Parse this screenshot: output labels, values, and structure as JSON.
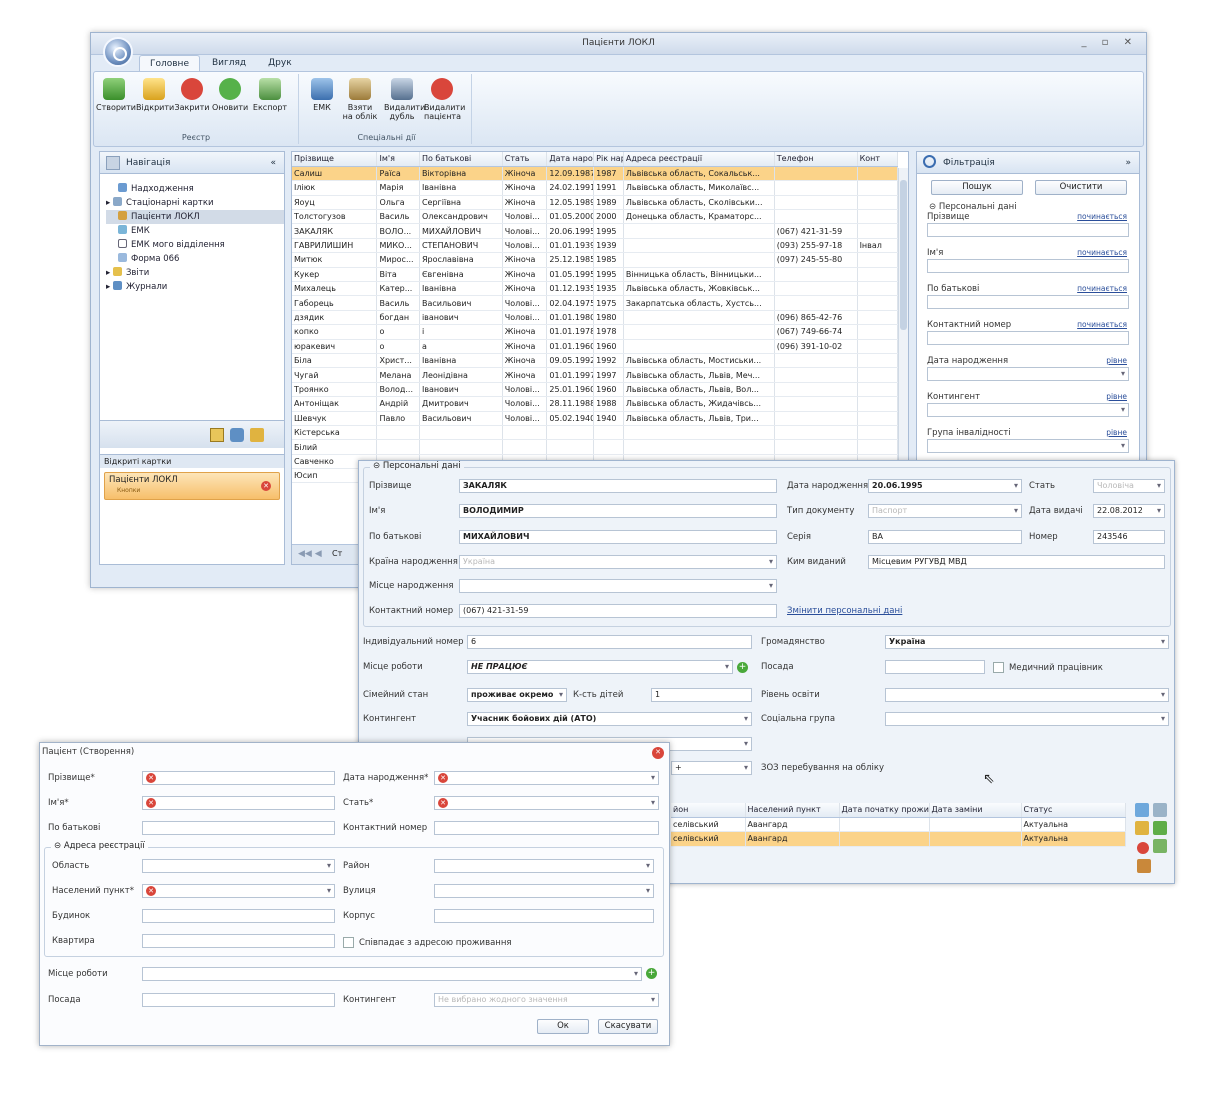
{
  "window": {
    "title": "Пацієнти ЛОКЛ"
  },
  "tabs": [
    "Головне",
    "Вигляд",
    "Друк"
  ],
  "ribbon": {
    "registry": {
      "label": "Реєстр",
      "buttons": [
        "Створити",
        "Відкрити",
        "Закрити",
        "Оновити",
        "Експорт"
      ]
    },
    "special": {
      "label": "Спеціальні дії",
      "buttons": [
        "ЕМК",
        "Взяти на облік",
        "Видалити дубль",
        "Видалити пацієнта"
      ]
    }
  },
  "nav": {
    "title": "Навігація",
    "items": [
      "Надходження",
      "Стаціонарні картки",
      "Пацієнти ЛОКЛ",
      "ЕМК",
      "ЕМК мого відділення",
      "Форма 066",
      "Звіти",
      "Журнали"
    ],
    "open_cards_title": "Відкриті картки",
    "open_card": {
      "title": "Пацієнти ЛОКЛ",
      "sub": "Кнопки"
    }
  },
  "grid": {
    "columns": [
      "Прізвище",
      "Ім'я",
      "По батькові",
      "Стать",
      "Дата народж",
      "Рік нарож",
      "Адреса реєстрації",
      "Телефон",
      "Конт"
    ],
    "rows": [
      [
        "Салиш",
        "Раїса",
        "Вікторівна",
        "Жіноча",
        "12.09.1987",
        "1987",
        "Львівська область, Сокальськ...",
        "",
        ""
      ],
      [
        "Іліюк",
        "Марія",
        "Іванівна",
        "Жіноча",
        "24.02.1991",
        "1991",
        "Львівська область, Миколаївс...",
        "",
        ""
      ],
      [
        "Яоуц",
        "Ольга",
        "Сергіївна",
        "Жіноча",
        "12.05.1989",
        "1989",
        "Львівська область, Сколівськи...",
        "",
        ""
      ],
      [
        "Толстогузов",
        "Василь",
        "Олександрович",
        "Чолові...",
        "01.05.2000",
        "2000",
        "Донецька область, Краматорс...",
        "",
        ""
      ],
      [
        "ЗАКАЛЯК",
        "ВОЛО...",
        "МИХАЙЛОВИЧ",
        "Чолові...",
        "20.06.1995",
        "1995",
        "",
        "(067) 421-31-59",
        ""
      ],
      [
        "ГАВРИЛИШИН",
        "МИКО...",
        "СТЕПАНОВИЧ",
        "Чолові...",
        "01.01.1939",
        "1939",
        "",
        "(093) 255-97-18",
        "Інвал"
      ],
      [
        "Митюк",
        "Мирос...",
        "Ярославівна",
        "Жіноча",
        "25.12.1985",
        "1985",
        "",
        "(097) 245-55-80",
        ""
      ],
      [
        "Кукер",
        "Віта",
        "Євгенівна",
        "Жіноча",
        "01.05.1995",
        "1995",
        "Вінницька область, Вінницьки...",
        "",
        ""
      ],
      [
        "Михалець",
        "Катер...",
        "Іванівна",
        "Жіноча",
        "01.12.1935",
        "1935",
        "Львівська область, Жовківськ...",
        "",
        ""
      ],
      [
        "Габорець",
        "Василь",
        "Васильович",
        "Чолові...",
        "02.04.1975",
        "1975",
        "Закарпатська область, Хустсь...",
        "",
        ""
      ],
      [
        "дзядик",
        "богдан",
        "іванович",
        "Чолові...",
        "01.01.1980",
        "1980",
        "",
        "(096) 865-42-76",
        ""
      ],
      [
        "копко",
        "о",
        "і",
        "Жіноча",
        "01.01.1978",
        "1978",
        "",
        "(067) 749-66-74",
        ""
      ],
      [
        "юракевич",
        "о",
        "а",
        "Жіноча",
        "01.01.1960",
        "1960",
        "",
        "(096) 391-10-02",
        ""
      ],
      [
        "Біла",
        "Христ...",
        "Іванівна",
        "Жіноча",
        "09.05.1992",
        "1992",
        "Львівська область, Мостиськи...",
        "",
        ""
      ],
      [
        "Чугай",
        "Мелана",
        "Леонідівна",
        "Жіноча",
        "01.01.1997",
        "1997",
        "Львівська область, Львів, Меч...",
        "",
        ""
      ],
      [
        "Троянко",
        "Волод...",
        "Іванович",
        "Чолові...",
        "25.01.1960",
        "1960",
        "Львівська область, Львів, Вол...",
        "",
        ""
      ],
      [
        "Антоніщак",
        "Андрій",
        "Дмитрович",
        "Чолові...",
        "28.11.1988",
        "1988",
        "Львівська область, Жидачівсь...",
        "",
        ""
      ],
      [
        "Шевчук",
        "Павло",
        "Васильович",
        "Чолові...",
        "05.02.1940",
        "1940",
        "Львівська область, Львів, Три...",
        "",
        ""
      ],
      [
        "Кістерська",
        "",
        "",
        "",
        "",
        "",
        "",
        "",
        ""
      ],
      [
        "Білий",
        "",
        "",
        "",
        "",
        "",
        "",
        "",
        ""
      ],
      [
        "Савченко",
        "",
        "",
        "",
        "",
        "",
        "",
        "",
        ""
      ],
      [
        "Юсип",
        "",
        "",
        "",
        "",
        "",
        "",
        "",
        ""
      ]
    ],
    "pager_label": "Ст"
  },
  "filter": {
    "title": "Фільтрація",
    "search": "Пошук",
    "clear": "Очистити",
    "group": "Персональні дані",
    "fields": [
      {
        "label": "Прізвище",
        "mode": "починається"
      },
      {
        "label": "Ім'я",
        "mode": "починається"
      },
      {
        "label": "По батькові",
        "mode": "починається"
      },
      {
        "label": "Контактний номер",
        "mode": "починається"
      },
      {
        "label": "Дата народження",
        "mode": "рівне"
      },
      {
        "label": "Контингент",
        "mode": "рівне"
      },
      {
        "label": "Група інвалідності",
        "mode": "рівне"
      }
    ]
  },
  "emk": {
    "group": "Персональні дані",
    "surname_label": "Прізвище",
    "surname": "ЗАКАЛЯК",
    "name_label": "Ім'я",
    "name": "ВОЛОДИМИР",
    "patronymic_label": "По батькові",
    "patronymic": "МИХАЙЛОВИЧ",
    "country_label": "Країна народження",
    "country": "Україна",
    "birthplace_label": "Місце народження",
    "phone_label": "Контактний номер",
    "phone": "(067) 421-31-59",
    "dob_label": "Дата народження",
    "dob": "20.06.1995",
    "sex_label": "Стать",
    "sex": "Чоловіча",
    "doctype_label": "Тип документу",
    "doctype": "Паспорт",
    "issued_label": "Дата видачі",
    "issued": "22.08.2012",
    "series_label": "Серія",
    "series": "ВА",
    "number_label": "Номер",
    "number": "243546",
    "issuer_label": "Ким виданий",
    "issuer": "Місцевим РУГУВД МВД",
    "change_link": "Змінити персональні дані",
    "id_label": "Індивідуальний номер",
    "id": "6",
    "citizen_label": "Громадянство",
    "citizen": "Україна",
    "work_label": "Місце роботи",
    "work": "НЕ ПРАЦЮЄ",
    "position_label": "Посада",
    "medworker_label": "Медичний працівник",
    "family_label": "Сімейний стан",
    "family": "проживає окремо",
    "kids_label": "К-сть дітей",
    "kids": "1",
    "edu_label": "Рівень освіти",
    "contingent_label": "Контингент",
    "contingent": "Учасник бойових дій (АТО)",
    "social_label": "Соціальна група",
    "zoz_label": "ЗОЗ перебування на обліку",
    "addr_cols": [
      "йон",
      "Населений пункт",
      "Дата початку прожи",
      "Дата заміни",
      "Статус"
    ],
    "addr_rows": [
      [
        "селівський",
        "Авангард",
        "",
        "",
        "Актуальна"
      ],
      [
        "селівський",
        "Авангард",
        "",
        "",
        "Актуальна"
      ]
    ]
  },
  "create": {
    "title": "Пацієнт (Створення)",
    "surname_label": "Прізвище*",
    "name_label": "Ім'я*",
    "patronymic_label": "По батькові",
    "dob_label": "Дата народження*",
    "sex_label": "Стать*",
    "phone_label": "Контактний номер",
    "addr_group": "Адреса реєстрації",
    "region_label": "Область",
    "district_label": "Район",
    "town_label": "Населений пункт*",
    "street_label": "Вулиця",
    "house_label": "Будинок",
    "block_label": "Корпус",
    "flat_label": "Квартира",
    "same_label": "Співпадає з адресою проживання",
    "work_label": "Місце роботи",
    "position_label": "Посада",
    "contingent_label": "Контингент",
    "contingent_placeholder": "Не вибрано жодного значення",
    "ok": "Ок",
    "cancel": "Скасувати"
  }
}
